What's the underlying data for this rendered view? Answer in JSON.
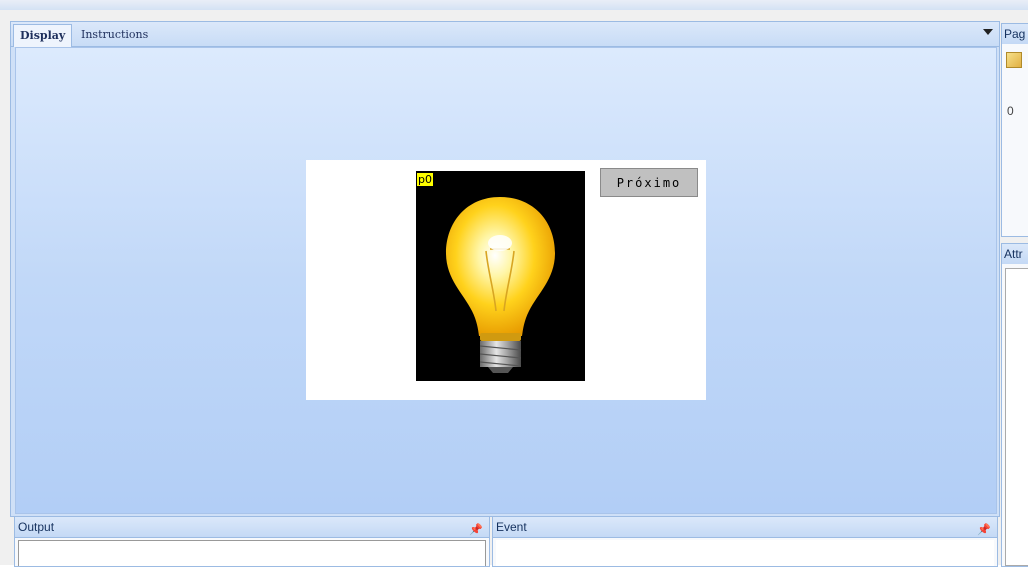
{
  "tabs": {
    "display": "Display",
    "instructions": "Instructions"
  },
  "screen": {
    "picture_id": "p0",
    "button_id": "b0",
    "button_label": "Próximo"
  },
  "panels": {
    "output": "Output",
    "event": "Event",
    "pin_icon": "pin-icon"
  },
  "side": {
    "page_header": "Pag",
    "page_value": "0",
    "attr_header": "Attr"
  },
  "colors": {
    "id_badge": "#ffff00",
    "button_bg": "#c0c0c0",
    "panel_header": "#c8dcf6"
  }
}
